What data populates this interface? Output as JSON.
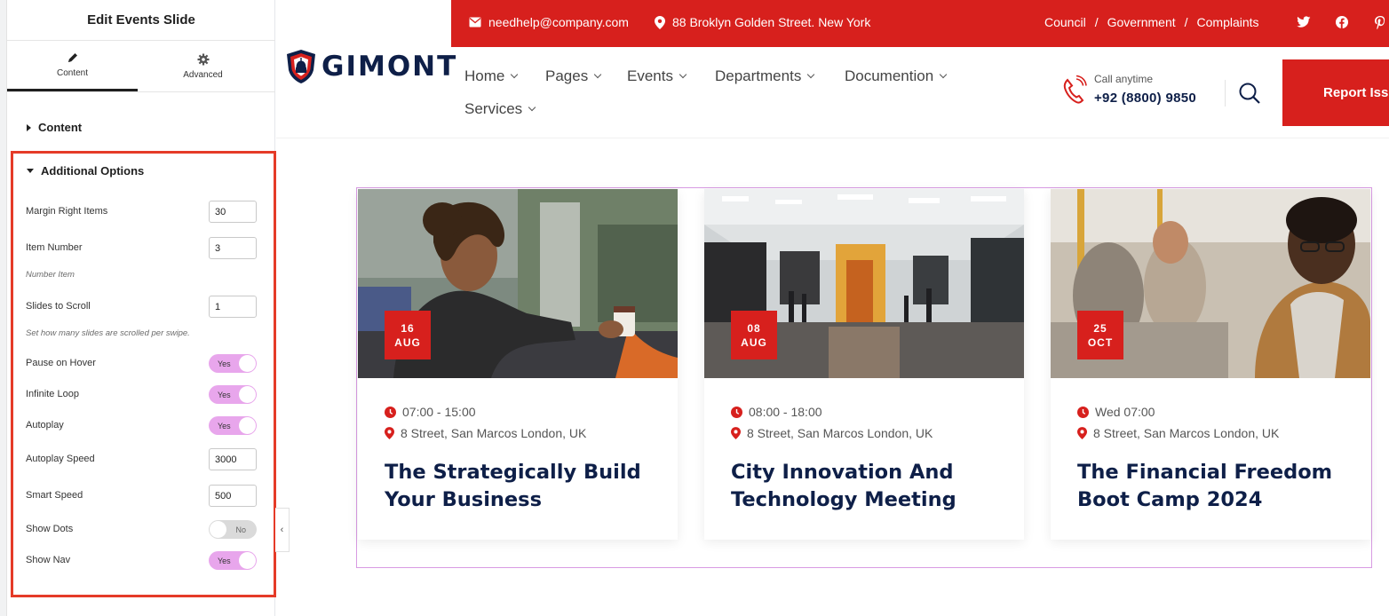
{
  "editor": {
    "title": "Edit Events Slide",
    "tabs": [
      {
        "label": "Content",
        "icon": "pencil-icon",
        "active": true
      },
      {
        "label": "Advanced",
        "icon": "gear-icon",
        "active": false
      }
    ],
    "sections": {
      "content": "Content",
      "additional": "Additional Options"
    },
    "controls": {
      "margin_right": {
        "label": "Margin Right Items",
        "value": "30"
      },
      "item_number": {
        "label": "Item Number",
        "value": "3",
        "help": "Number Item"
      },
      "slides_to_scroll": {
        "label": "Slides to Scroll",
        "value": "1",
        "help": "Set how many slides are scrolled per swipe."
      },
      "pause_on_hover": {
        "label": "Pause on Hover",
        "state": "Yes"
      },
      "infinite_loop": {
        "label": "Infinite Loop",
        "state": "Yes"
      },
      "autoplay": {
        "label": "Autoplay",
        "state": "Yes"
      },
      "autoplay_speed": {
        "label": "Autoplay Speed",
        "value": "3000"
      },
      "smart_speed": {
        "label": "Smart Speed",
        "value": "500"
      },
      "show_dots": {
        "label": "Show Dots",
        "state": "No"
      },
      "show_nav": {
        "label": "Show Nav",
        "state": "Yes"
      }
    },
    "highlight_color": "#e53b28"
  },
  "site": {
    "topbar": {
      "email": "needhelp@company.com",
      "address": "88 Broklyn Golden Street. New York",
      "links": [
        "Council",
        "Government",
        "Complaints"
      ],
      "separator": "/",
      "social": [
        "twitter-icon",
        "facebook-icon",
        "pinterest-icon"
      ]
    },
    "logo": "GIMONT",
    "nav": [
      "Home",
      "Pages",
      "Events",
      "Departments",
      "Documention",
      "Services"
    ],
    "call": {
      "label": "Call anytime",
      "number": "+92 (8800) 9850"
    },
    "cta": "Report Iss",
    "brand_color": "#d7201d",
    "navy_color": "#0e1f48"
  },
  "events": [
    {
      "day": "16",
      "month": "AUG",
      "time": "07:00 - 15:00",
      "location": "8 Street, San Marcos London, UK",
      "title": "The Strategically Build Your Business"
    },
    {
      "day": "08",
      "month": "AUG",
      "time": "08:00 - 18:00",
      "location": "8 Street, San Marcos London, UK",
      "title": "City Innovation And Technology Meeting"
    },
    {
      "day": "25",
      "month": "OCT",
      "time": "Wed 07:00",
      "location": "8 Street, San Marcos London, UK",
      "title": "The Financial Freedom Boot Camp 2024"
    }
  ]
}
